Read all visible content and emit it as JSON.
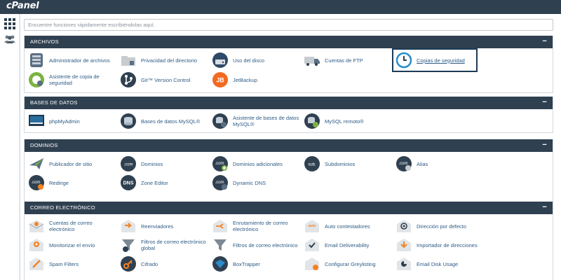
{
  "app": {
    "logo": "cPanel"
  },
  "search": {
    "placeholder": "Encuentre funciones rápidamente escribiéndolas aquí."
  },
  "sections": {
    "archivos": {
      "title": "ARCHIVOS",
      "items": {
        "admin": "Administrador de archivos",
        "privacidad": "Privacidad del directorio",
        "disco": "Uso del disco",
        "ftp": "Cuentas de FTP",
        "copias": "Copias de seguridad",
        "asistente": "Asistente de copia de seguridad",
        "git": "Git™ Version Control",
        "jetbackup": "JetBackup"
      }
    },
    "bases": {
      "title": "BASES DE DATOS",
      "items": {
        "phpmyadmin": "phpMyAdmin",
        "mysql": "Bases de datos MySQL®",
        "asistente_mysql": "Asistente de bases de datos MySQL®",
        "remoto": "MySQL remoto®"
      }
    },
    "dominios": {
      "title": "DOMINIOS",
      "items": {
        "publicador": "Publicador de sitio",
        "dominios": "Dominios",
        "adicionales": "Dominios adicionales",
        "subdominios": "Subdominios",
        "alias": "Alias",
        "redirige": "Redirige",
        "zone": "Zone Editor",
        "dns": "Dynamic DNS"
      }
    },
    "correo": {
      "title": "CORREO ELECTRÓNICO",
      "items": {
        "cuentas": "Cuentas de correo electrónico",
        "reenviadores": "Reenviadores",
        "enrutamiento": "Enrutamiento de correo electrónico",
        "auto": "Auto contestadores",
        "direccion": "Dirección por defecto",
        "monitorizar": "Monitorizar el envío",
        "filtros_global": "Filtros de correo electrónico global",
        "filtros": "Filtros de correo electrónico",
        "deliverability": "Email Deliverability",
        "importador": "Importador de direcciones",
        "spam": "Spam Filters",
        "cifrado": "Cifrado",
        "boxtrapper": "BoxTrapper",
        "greylisting": "Configurar Greylisting",
        "disk_usage": "Email Disk Usage"
      }
    }
  },
  "icon_labels": {
    "com": ".com",
    "sub": "sub.",
    "dns": "DNS",
    "auto": "auto",
    "jet": "JB"
  },
  "collapse_symbol": "−",
  "colors": {
    "header": "#2f4050",
    "link": "#2e5c86",
    "accent": "#f58220",
    "highlight_border": "#1d3b57"
  }
}
